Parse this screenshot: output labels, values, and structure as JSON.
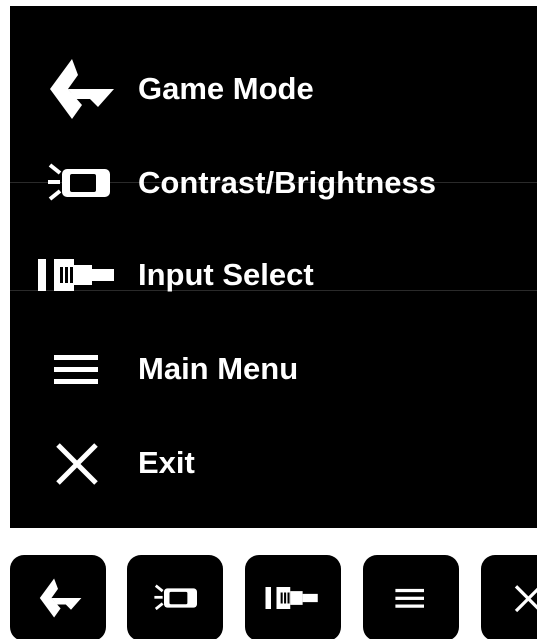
{
  "menu": {
    "items": [
      {
        "id": "game-mode",
        "label": "Game Mode",
        "icon": "game-mode-icon"
      },
      {
        "id": "contrast-brightness",
        "label": "Contrast/Brightness",
        "icon": "contrast-brightness-icon"
      },
      {
        "id": "input-select",
        "label": "Input Select",
        "icon": "input-select-icon"
      },
      {
        "id": "main-menu",
        "label": "Main Menu",
        "icon": "main-menu-icon"
      },
      {
        "id": "exit",
        "label": "Exit",
        "icon": "exit-icon"
      }
    ]
  },
  "hotkeys": [
    {
      "icon": "game-mode-icon"
    },
    {
      "icon": "contrast-brightness-icon"
    },
    {
      "icon": "input-select-icon"
    },
    {
      "icon": "main-menu-icon"
    },
    {
      "icon": "exit-icon"
    }
  ],
  "colors": {
    "panel_bg": "#000000",
    "text": "#ffffff",
    "page_bg": "#ffffff"
  }
}
